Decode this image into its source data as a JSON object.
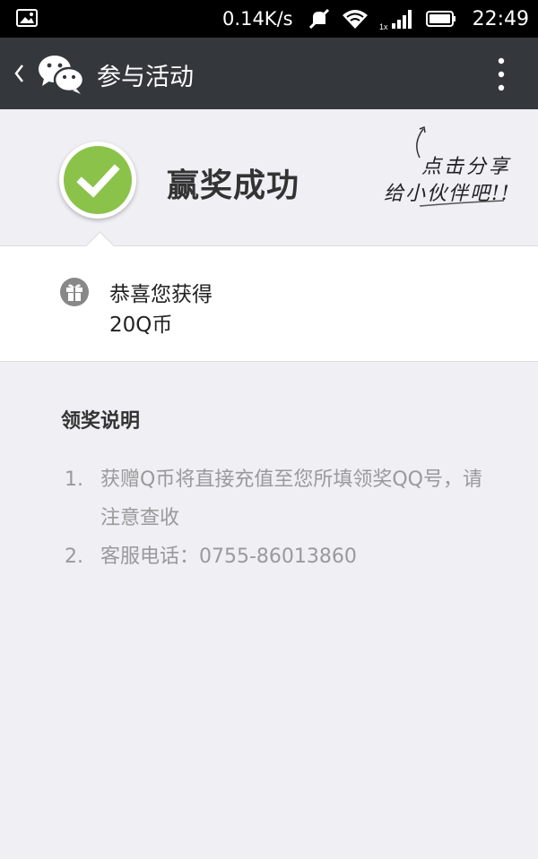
{
  "status_bar": {
    "network_speed": "0.14K/s",
    "time": "22:49",
    "signal_badge": "1x",
    "icons": [
      "image-notification-icon",
      "mute-icon",
      "wifi-icon",
      "signal-icon",
      "battery-icon"
    ]
  },
  "action_bar": {
    "title": "参与活动",
    "icons": [
      "back-icon",
      "wechat-logo-icon",
      "more-icon"
    ]
  },
  "header": {
    "title": "赢奖成功",
    "share_hint_line1": "点击分享",
    "share_hint_line2": "给小伙伴吧!!",
    "check_color": "#8bc34a"
  },
  "prize": {
    "label": "恭喜您获得",
    "value": "20Q币"
  },
  "instructions": {
    "title": "领奖说明",
    "items": [
      {
        "num": "1.",
        "text": "获赠Q币将直接充值至您所填领奖QQ号，请注意查收"
      },
      {
        "num": "2.",
        "text": "客服电话：0755-86013860"
      }
    ]
  },
  "colors": {
    "action_bar_bg": "#34383d",
    "status_bar_bg": "#000000",
    "page_bg": "#efeff4",
    "accent_green": "#8bc34a"
  }
}
